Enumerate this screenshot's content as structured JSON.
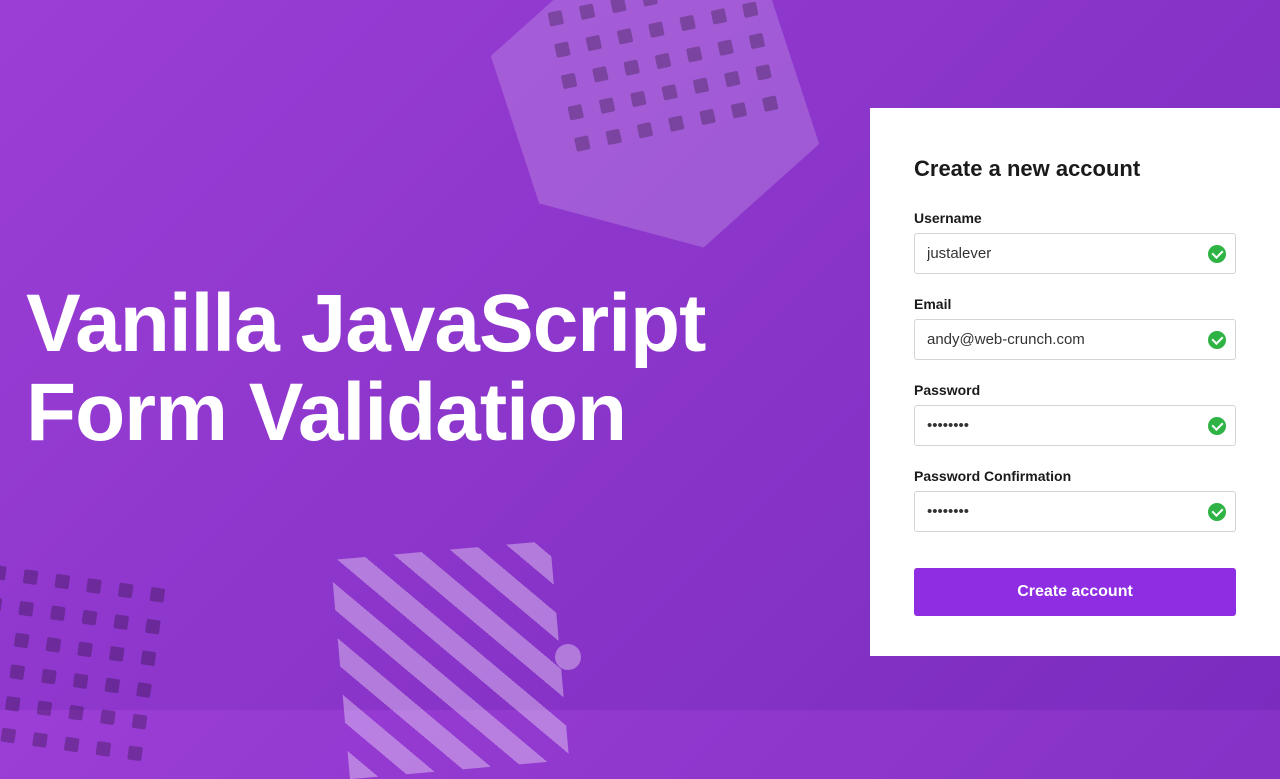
{
  "hero": {
    "title_line1": "Vanilla JavaScript",
    "title_line2": "Form Validation"
  },
  "form": {
    "heading": "Create a new account",
    "fields": {
      "username": {
        "label": "Username",
        "value": "justalever",
        "valid": true
      },
      "email": {
        "label": "Email",
        "value": "andy@web-crunch.com",
        "valid": true
      },
      "password": {
        "label": "Password",
        "value": "••••••••",
        "valid": true
      },
      "password_confirm": {
        "label": "Password Confirmation",
        "value": "••••••••",
        "valid": true
      }
    },
    "submit_label": "Create account"
  },
  "colors": {
    "primary": "#8e2de2",
    "success": "#2fb344",
    "text": "#1a1a1a"
  }
}
